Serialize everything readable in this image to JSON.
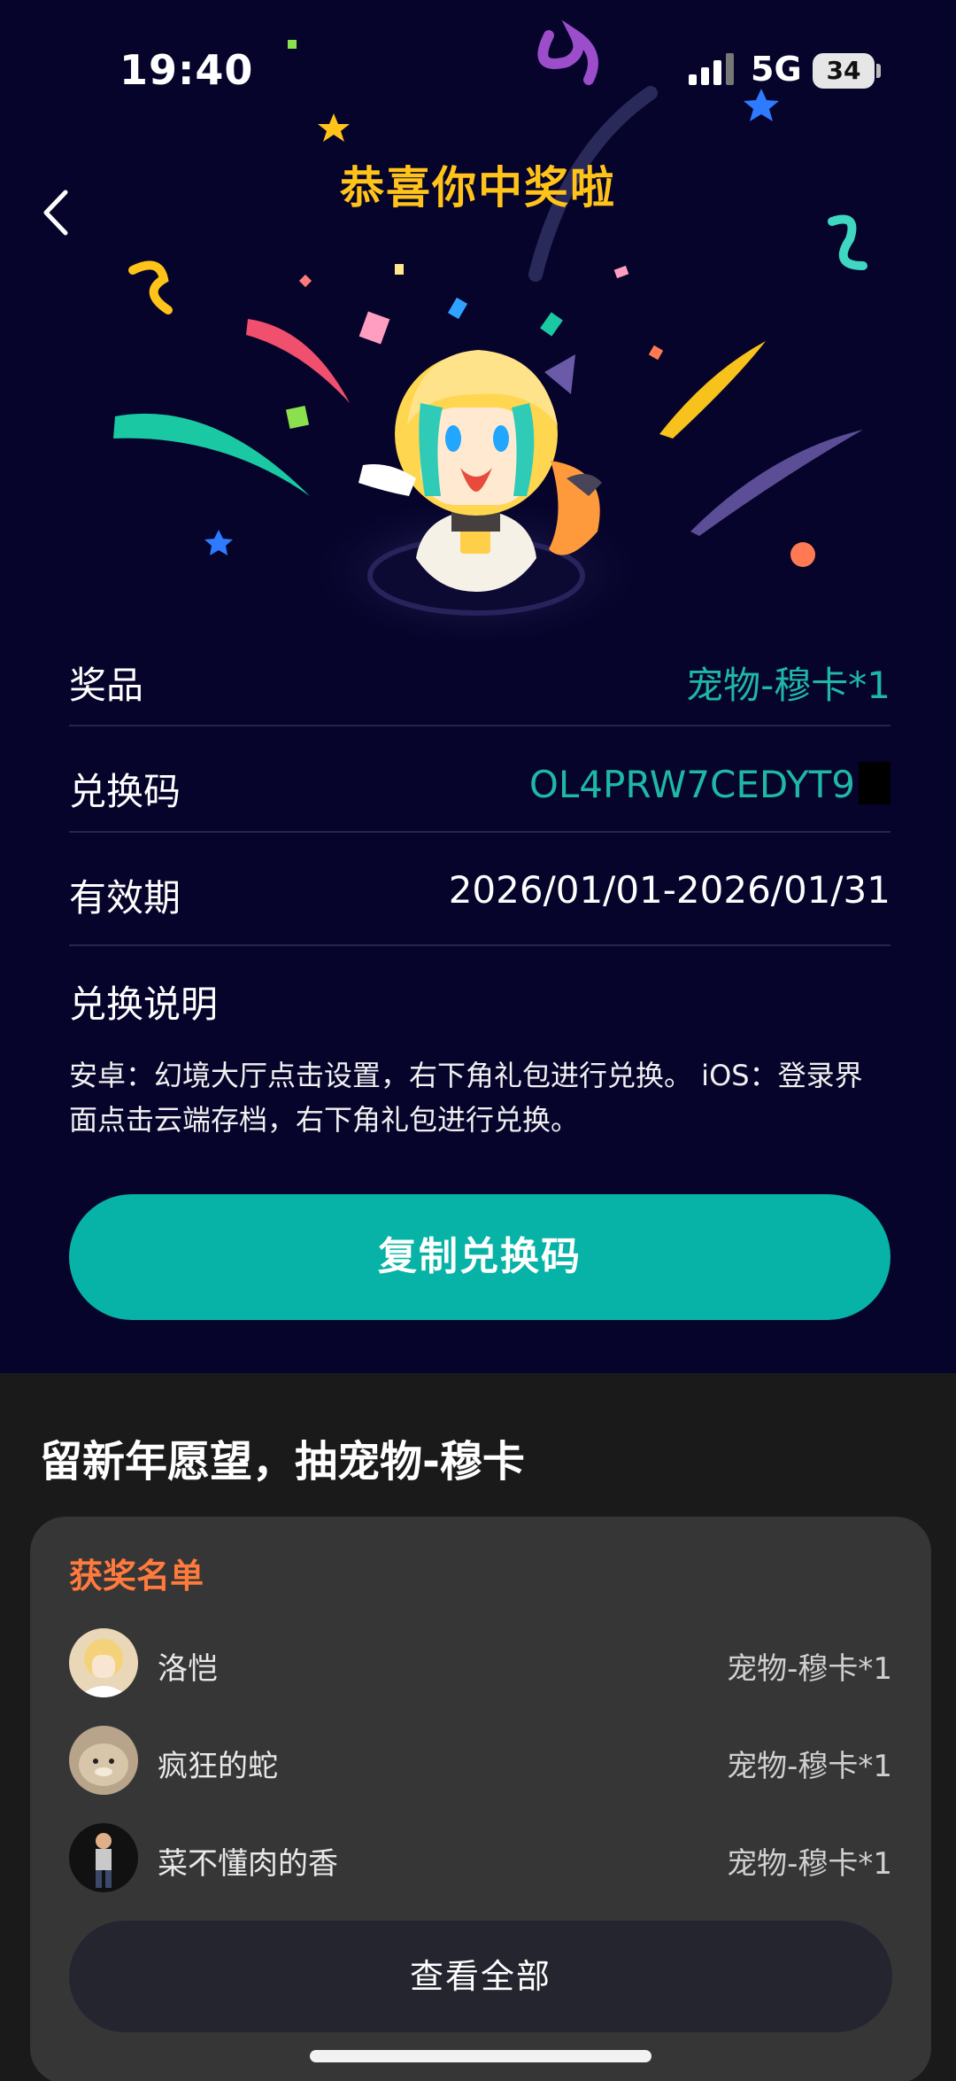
{
  "status_bar": {
    "time": "19:40",
    "network": "5G",
    "battery": "34"
  },
  "header": {
    "title": "恭喜你中奖啦"
  },
  "details": [
    {
      "label": "奖品",
      "value": "宠物-穆卡*1"
    },
    {
      "label": "兑换码",
      "value": "OL4PRW7CEDYT9"
    },
    {
      "label": "有效期",
      "value": "2026/01/01-2026/01/31"
    }
  ],
  "explanation": {
    "title": "兑换说明",
    "text": "安卓：幻境大厅点击设置，右下角礼包进行兑换。 iOS：登录界面点击云端存档，右下角礼包进行兑换。"
  },
  "copy_button": "复制兑换码",
  "bottom": {
    "title": "留新年愿望，抽宠物-穆卡",
    "winners_title": "获奖名单",
    "winners": [
      {
        "name": "洛恺",
        "prize": "宠物-穆卡*1"
      },
      {
        "name": "疯狂的蛇",
        "prize": "宠物-穆卡*1"
      },
      {
        "name": "菜不懂肉的香",
        "prize": "宠物-穆卡*1"
      }
    ],
    "view_all": "查看全部"
  },
  "colors": {
    "background_top": "#06042b",
    "title_gold": "#ffc31a",
    "accent_teal": "#06b3a6",
    "winners_orange": "#ff7a3c"
  }
}
